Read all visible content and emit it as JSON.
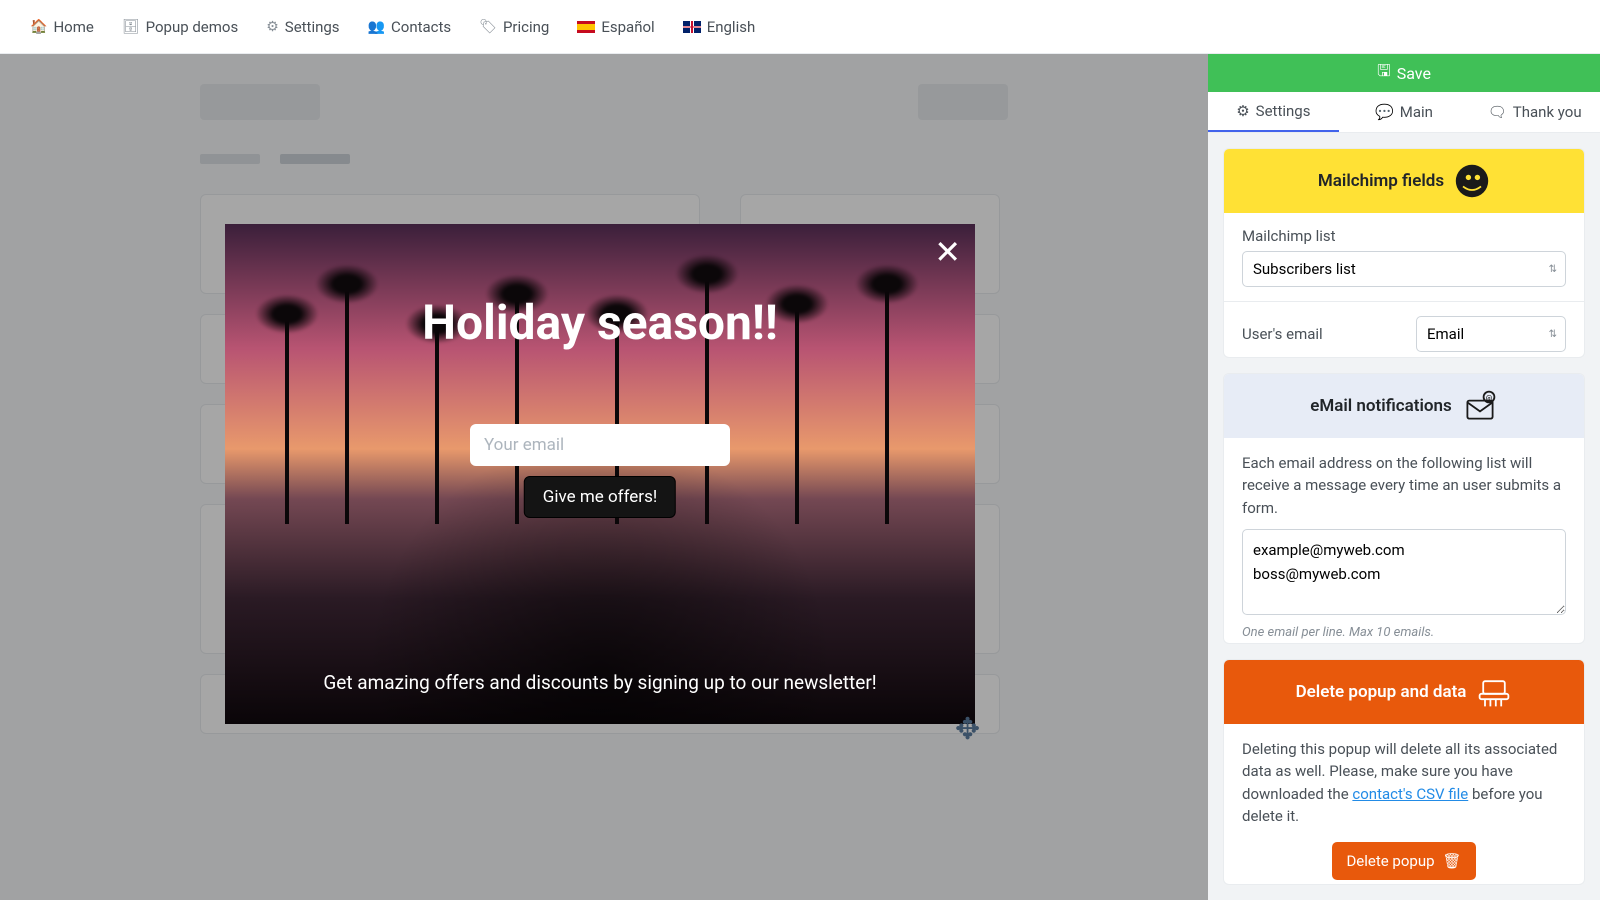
{
  "nav": {
    "home": "Home",
    "popup_demos": "Popup demos",
    "settings": "Settings",
    "contacts": "Contacts",
    "pricing": "Pricing",
    "spanish": "Español",
    "english": "English"
  },
  "popup": {
    "title": "Holiday season!!",
    "email_placeholder": "Your email",
    "button": "Give me offers!",
    "subtitle": "Get amazing offers and discounts by signing up to our newsletter!"
  },
  "sidebar": {
    "save": "Save",
    "tabs": {
      "settings": "Settings",
      "main": "Main",
      "thankyou": "Thank you"
    }
  },
  "mailchimp": {
    "header": "Mailchimp fields",
    "list_label": "Mailchimp list",
    "list_value": "Subscribers list",
    "email_label": "User's email",
    "email_value": "Email"
  },
  "email_notif": {
    "header": "eMail notifications",
    "desc": "Each email address on the following list will receive a message every time an user submits a form.",
    "value": "example@myweb.com\nboss@myweb.com",
    "hint": "One email per line. Max 10 emails."
  },
  "delete": {
    "header": "Delete popup and data",
    "desc_1": "Deleting this popup will delete all its associated data as well. Please, make sure you have downloaded the ",
    "link": "contact's CSV file",
    "desc_2": " before you delete it.",
    "button": "Delete popup"
  }
}
